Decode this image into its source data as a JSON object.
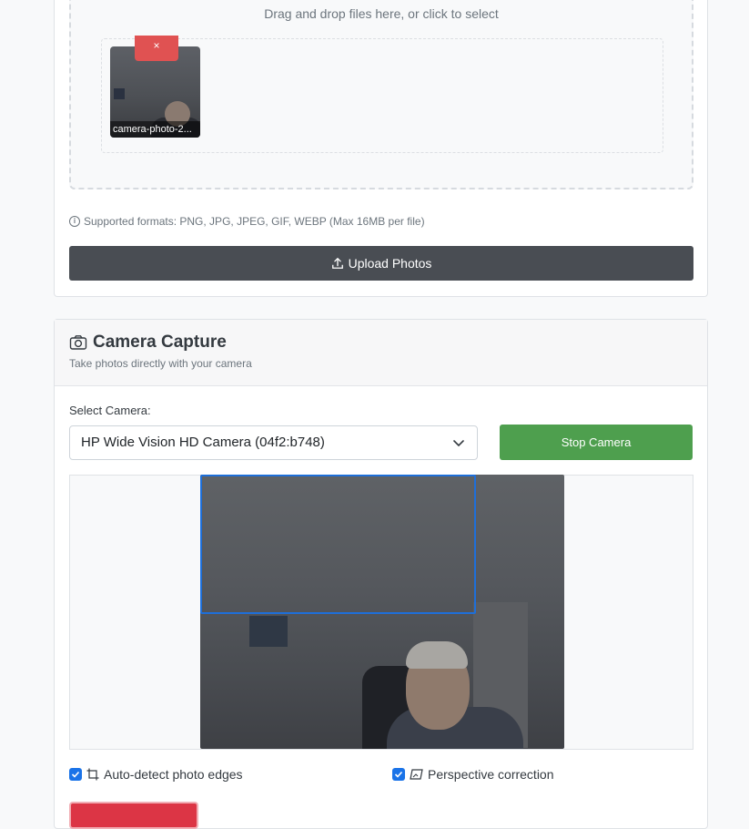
{
  "upload": {
    "drop_hint": "Drag and drop files here, or click to select",
    "preview": {
      "filename": "camera-photo-2...",
      "remove_label": "×"
    },
    "supported_formats": "Supported formats: PNG, JPG, JPEG, GIF, WEBP (Max 16MB per file)",
    "upload_button": "Upload Photos"
  },
  "camera": {
    "title": "Camera Capture",
    "subtitle": "Take photos directly with your camera",
    "select_label": "Select Camera:",
    "selected_camera": "HP Wide Vision HD Camera (04f2:b748)",
    "stop_button": "Stop Camera",
    "options": {
      "auto_detect_label": "Auto-detect photo edges",
      "auto_detect_checked": true,
      "perspective_label": "Perspective correction",
      "perspective_checked": true
    }
  },
  "colors": {
    "upload_button_bg": "#494d53",
    "stop_button_bg": "#4e9f4e",
    "remove_button_bg": "#e05252",
    "checkbox": "#1a73e8",
    "detection_box": "#1e6fd9"
  },
  "icons": {
    "info": "info-icon",
    "upload": "upload-icon",
    "camera": "camera-icon",
    "chevron": "chevron-down-icon",
    "crop": "crop-icon",
    "perspective": "perspective-icon"
  }
}
